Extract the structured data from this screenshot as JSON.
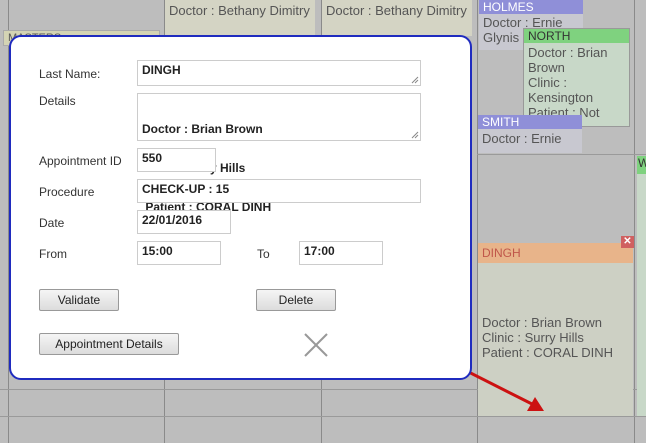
{
  "calendar": {
    "col1_doctor": "Doctor : Bethany Dimitry",
    "col2_doctor": "Doctor : Bethany Dimitry",
    "holmes": {
      "name": "HOLMES",
      "doctor": "Doctor : Ernie Glynis"
    },
    "north": {
      "name": "NORTH",
      "doctor": "Doctor : Brian Brown",
      "clinic": "Clinic : Kensington",
      "patient": "Patient : Not"
    },
    "smith": {
      "name": "SMITH",
      "doctor": "Doctor : Ernie"
    },
    "dingh_card": {
      "name": "DINGH",
      "doctor": "Doctor : Brian Brown",
      "clinic": "Clinic : Surry Hills",
      "patient": "Patient : CORAL DINH",
      "close": "✕"
    },
    "left_partial": "MASTERS",
    "right_partial": "W"
  },
  "dialog": {
    "last_name_label": "Last Name:",
    "last_name_value": "DINGH",
    "details_label": "Details",
    "details_line1": "Doctor : Brian Brown",
    "details_line2": "Clinic : Surry Hills",
    "details_line3": " Patient : CORAL DINH",
    "appointment_id_label": "Appointment ID",
    "appointment_id_value": "550",
    "procedure_label": "Procedure",
    "procedure_value": "CHECK-UP : 15",
    "date_label": "Date",
    "date_value": "22/01/2016",
    "from_label": "From",
    "from_value": "15:00",
    "to_label": "To",
    "to_value": "17:00",
    "validate_button": "Validate",
    "delete_button": "Delete",
    "appointment_details_button": "Appointment Details",
    "close_icon": "close-icon"
  },
  "colors": {
    "dialog_border": "#1f2bbf",
    "holmes_header": "#8f8fd8",
    "north_header": "#7fd27f",
    "smith_header": "#8f8fd8",
    "dingh_header": "#e8b48a",
    "arrow": "#cc1111"
  }
}
